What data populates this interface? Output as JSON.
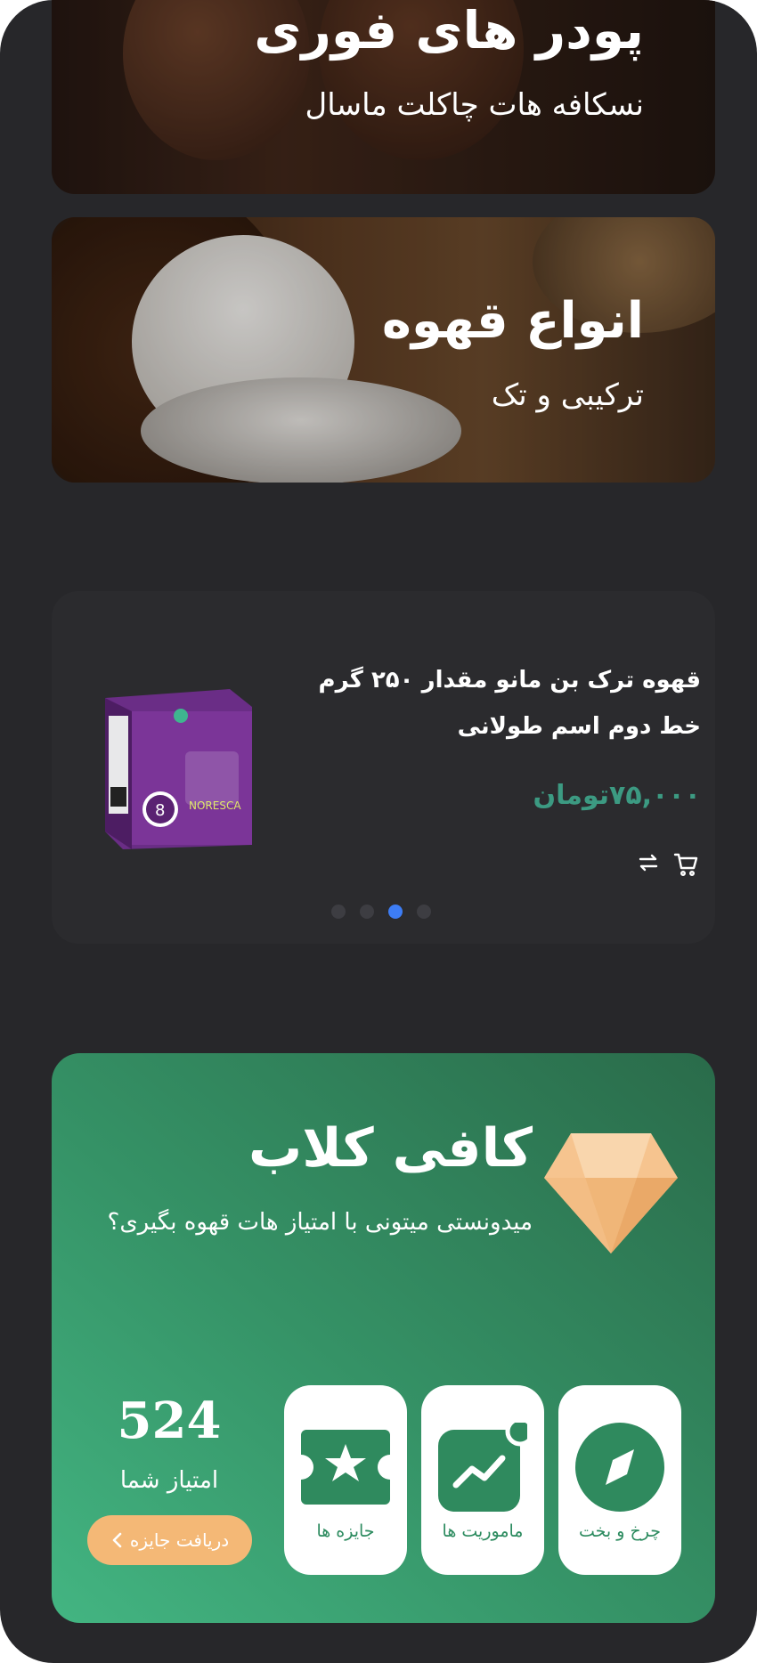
{
  "banners": [
    {
      "title": "پودر های فوری",
      "subtitle": "نسکافه هات چاکلت ماسال"
    },
    {
      "title": "انواع قهوه",
      "subtitle": "ترکیبی و تک"
    }
  ],
  "product": {
    "title": "قهوه ترک بن مانو مقدار ۲۵۰ گرم خط دوم اسم طولانی",
    "price": "۷۵,۰۰۰تومان",
    "carousel": {
      "count": 4,
      "active_index": 2
    },
    "icons": [
      "cart-icon",
      "compare-icon"
    ]
  },
  "club": {
    "title": "کافی کلاب",
    "description": "میدونستی میتونی با امتیاز هات قهوه بگیری؟",
    "tiles": [
      {
        "label": "چرخ و بخت",
        "icon": "compass-icon"
      },
      {
        "label": "ماموریت ها",
        "icon": "trend-icon"
      },
      {
        "label": "جایزه ها",
        "icon": "ticket-star-icon"
      }
    ],
    "score": "524",
    "score_label": "امتیاز شما",
    "reward_button": "دریافت جایزه"
  },
  "colors": {
    "background": "#27272a",
    "club_green": "#359266",
    "price": "#3c9a82",
    "active_dot": "#3d7df5",
    "reward_button": "#f4b876"
  }
}
